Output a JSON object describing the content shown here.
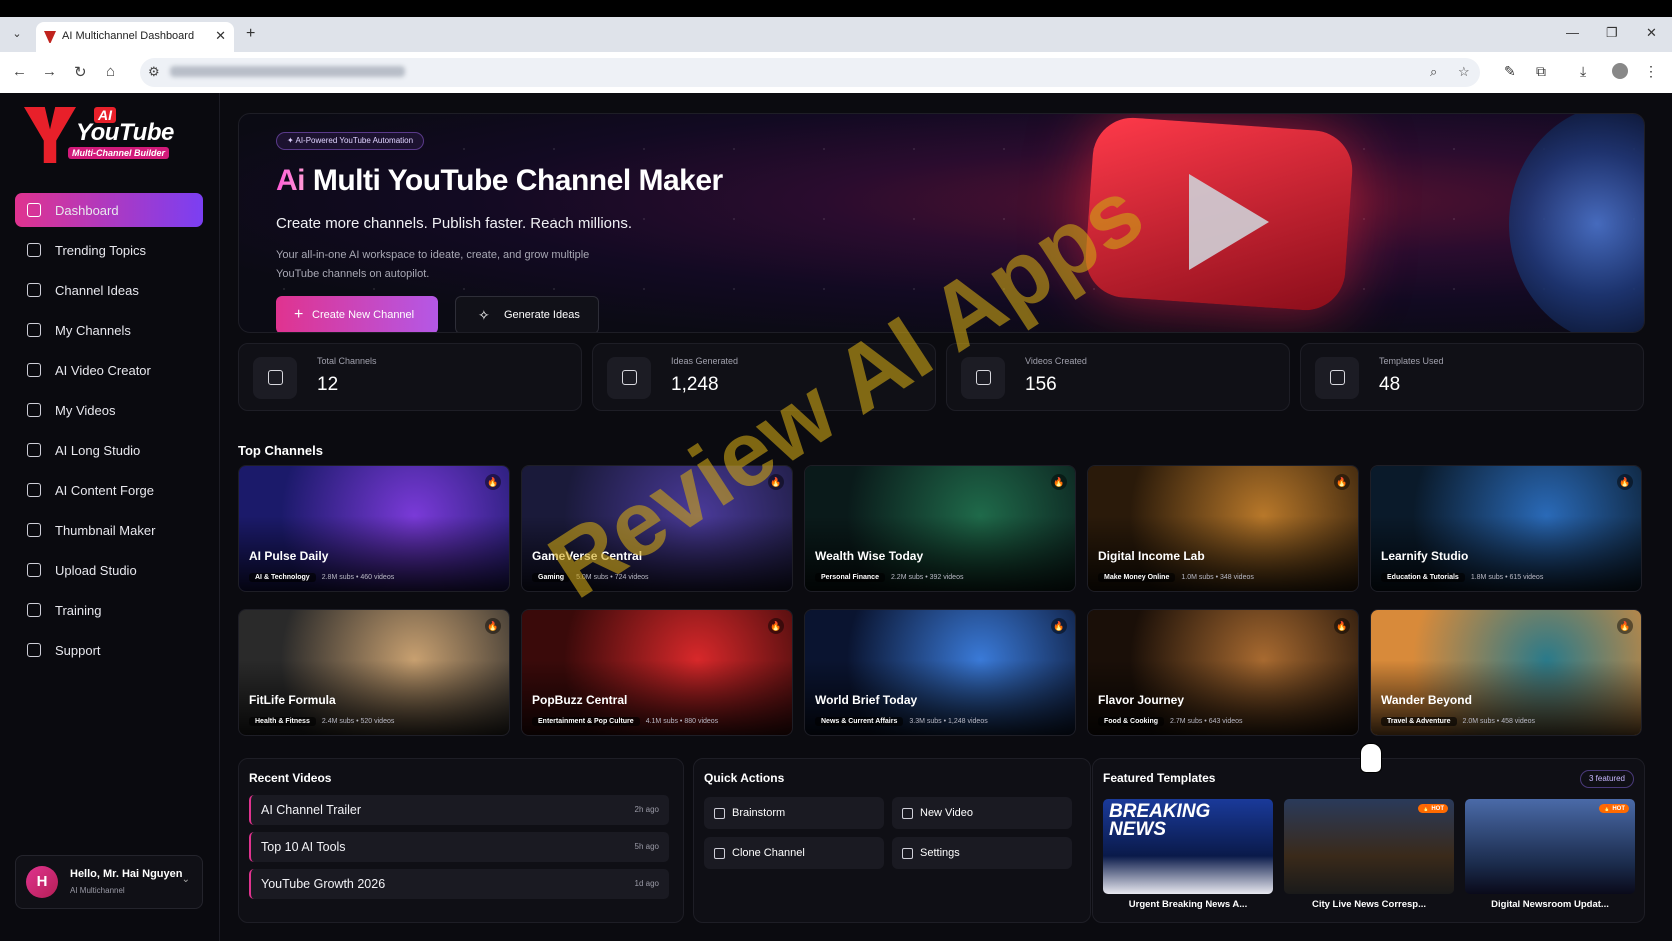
{
  "browser": {
    "tab_title": "AI Multichannel Dashboard",
    "close_glyph": "✕",
    "new_tab_glyph": "+"
  },
  "sidebar": {
    "logo": {
      "ai": "AI",
      "brand": "YouTube",
      "sub": "Multi-Channel Builder"
    },
    "items": [
      {
        "label": "Dashboard",
        "icon": "grid-icon",
        "active": true
      },
      {
        "label": "Trending Topics",
        "icon": "trending-icon"
      },
      {
        "label": "Channel Ideas",
        "icon": "lightbulb-icon"
      },
      {
        "label": "My Channels",
        "icon": "channels-icon"
      },
      {
        "label": "AI Video Creator",
        "icon": "video-creator-icon"
      },
      {
        "label": "My Videos",
        "icon": "video-icon"
      },
      {
        "label": "AI Long Studio",
        "icon": "film-icon"
      },
      {
        "label": "AI Content Forge",
        "icon": "document-icon"
      },
      {
        "label": "Thumbnail Maker",
        "icon": "image-icon"
      },
      {
        "label": "Upload Studio",
        "icon": "upload-icon"
      },
      {
        "label": "Training",
        "icon": "graduation-icon"
      },
      {
        "label": "Support",
        "icon": "headset-icon"
      }
    ],
    "user": {
      "initial": "H",
      "hello": "Hello, Mr. Hai Nguyen",
      "role": "AI Multichannel"
    }
  },
  "hero": {
    "badge": "✦ AI-Powered YouTube Automation",
    "title_accent": "Ai",
    "title_rest": " Multi YouTube Channel Maker",
    "tagline": "Create more channels. Publish faster. Reach millions.",
    "description": "Your all-in-one AI workspace to ideate, create, and grow multiple YouTube channels on autopilot.",
    "primary_button": "Create New Channel",
    "secondary_button": "Generate Ideas"
  },
  "stats": [
    {
      "label": "Total Channels",
      "value": "12",
      "icon": "video-camera-icon"
    },
    {
      "label": "Ideas Generated",
      "value": "1,248",
      "icon": "lightbulb-icon"
    },
    {
      "label": "Videos Created",
      "value": "156",
      "icon": "clapperboard-icon"
    },
    {
      "label": "Templates Used",
      "value": "48",
      "icon": "grid-icon"
    }
  ],
  "top_channels": {
    "title": "Top Channels",
    "items": [
      {
        "name": "AI Pulse Daily",
        "category": "AI & Technology",
        "subs": "2.8M subs",
        "videos": "460 videos",
        "color1": "#1b1a6a",
        "color2": "#7a3ad8"
      },
      {
        "name": "GameVerse Central",
        "category": "Gaming",
        "subs": "5.0M subs",
        "videos": "724 videos",
        "color1": "#1a1a3a",
        "color2": "#4a3a9a"
      },
      {
        "name": "Wealth Wise Today",
        "category": "Personal Finance",
        "subs": "2.2M subs",
        "videos": "392 videos",
        "color1": "#0a1a1a",
        "color2": "#1f6a4a"
      },
      {
        "name": "Digital Income Lab",
        "category": "Make Money Online",
        "subs": "1.0M subs",
        "videos": "348 videos",
        "color1": "#2a1a0a",
        "color2": "#b8782a"
      },
      {
        "name": "Learnify Studio",
        "category": "Education & Tutorials",
        "subs": "1.8M subs",
        "videos": "615 videos",
        "color1": "#0a1a2a",
        "color2": "#2a6ab8"
      },
      {
        "name": "FitLife Formula",
        "category": "Health & Fitness",
        "subs": "2.4M subs",
        "videos": "520 videos",
        "color1": "#2a2a2a",
        "color2": "#c8a070"
      },
      {
        "name": "PopBuzz Central",
        "category": "Entertainment & Pop Culture",
        "subs": "4.1M subs",
        "videos": "880 videos",
        "color1": "#3a0a0a",
        "color2": "#d8282a"
      },
      {
        "name": "World Brief Today",
        "category": "News & Current Affairs",
        "subs": "3.3M subs",
        "videos": "1,248 videos",
        "color1": "#0a1430",
        "color2": "#3a7ad8"
      },
      {
        "name": "Flavor Journey",
        "category": "Food & Cooking",
        "subs": "2.7M subs",
        "videos": "643 videos",
        "color1": "#1a0f08",
        "color2": "#a86a30"
      },
      {
        "name": "Wander Beyond",
        "category": "Travel & Adventure",
        "subs": "2.0M subs",
        "videos": "458 videos",
        "color1": "#d88a3a",
        "color2": "#2a7a8a"
      }
    ]
  },
  "recent_videos": {
    "title": "Recent Videos",
    "items": [
      {
        "title": "AI Channel Trailer",
        "age": "2h ago"
      },
      {
        "title": "Top 10 AI Tools",
        "age": "5h ago"
      },
      {
        "title": "YouTube Growth 2026",
        "age": "1d ago"
      }
    ]
  },
  "quick_actions": {
    "title": "Quick Actions",
    "items": [
      {
        "label": "Brainstorm",
        "icon": "wand-icon"
      },
      {
        "label": "New Video",
        "icon": "video-icon"
      },
      {
        "label": "Clone Channel",
        "icon": "copy-icon"
      },
      {
        "label": "Settings",
        "icon": "gear-icon"
      }
    ]
  },
  "featured_templates": {
    "title": "Featured Templates",
    "count": "3 featured",
    "items": [
      {
        "name": "Urgent Breaking News A...",
        "overlay": "BREAKING NEWS",
        "hot": ""
      },
      {
        "name": "City Live News Corresp...",
        "overlay": "",
        "hot": "🔥 HOT"
      },
      {
        "name": "Digital Newsroom Updat...",
        "overlay": "",
        "hot": "🔥 HOT"
      }
    ]
  },
  "watermark": "Review AI Apps"
}
